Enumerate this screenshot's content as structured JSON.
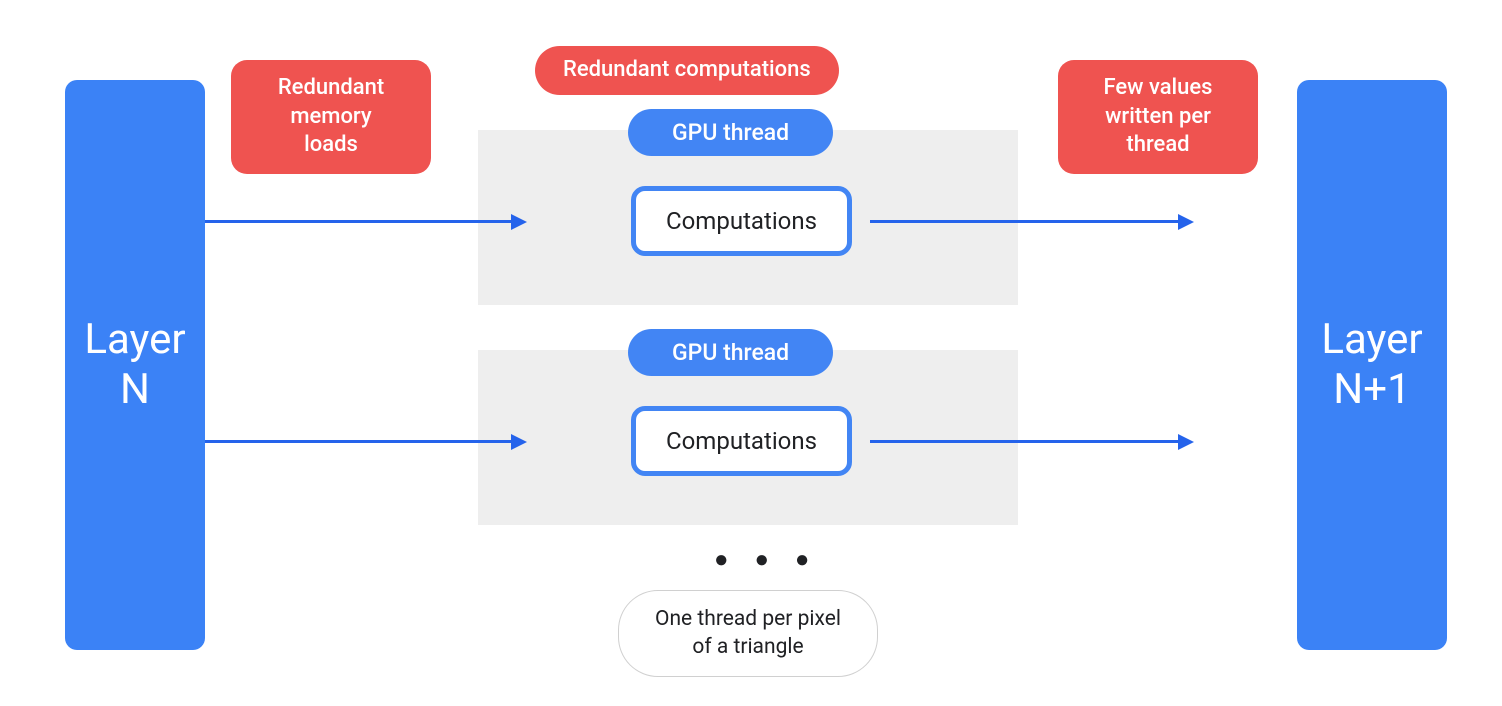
{
  "colors": {
    "blue": "#3b82f6",
    "blue_accent": "#4285f4",
    "red": "#ef5350",
    "gray": "#eeeeee"
  },
  "layers": {
    "left": "Layer\nN",
    "right": "Layer\nN+1"
  },
  "annotations": {
    "redundant_memory": "Redundant\nmemory\nloads",
    "redundant_computations": "Redundant computations",
    "few_values": "Few values\nwritten per\nthread",
    "one_thread": "One thread per pixel\nof a triangle"
  },
  "threads": {
    "gpu_thread_label": "GPU thread",
    "computations_label": "Computations"
  },
  "ellipsis": "● ● ●"
}
